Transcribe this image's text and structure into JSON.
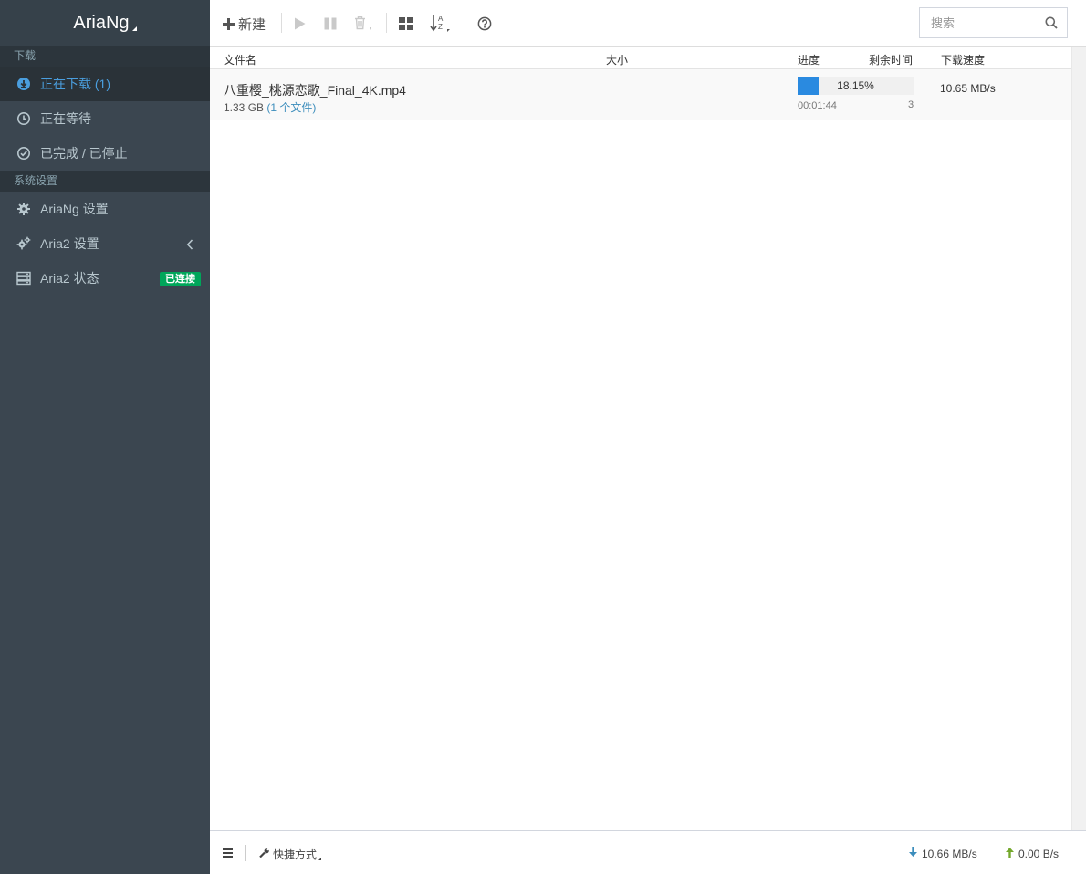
{
  "brand": {
    "title": "AriaNg"
  },
  "sidebar": {
    "sections": [
      {
        "header": "下载"
      },
      {
        "header": "系统设置"
      }
    ],
    "items": [
      {
        "label": "正在下载 (1)",
        "icon": "download-circle-icon"
      },
      {
        "label": "正在等待",
        "icon": "clock-icon"
      },
      {
        "label": "已完成 / 已停止",
        "icon": "check-circle-icon"
      },
      {
        "label": "AriaNg 设置",
        "icon": "gear-icon"
      },
      {
        "label": "Aria2 设置",
        "icon": "gears-icon"
      },
      {
        "label": "Aria2 状态",
        "icon": "server-icon",
        "badge": "已连接"
      }
    ]
  },
  "toolbar": {
    "new_label": "新建",
    "search_placeholder": "搜索"
  },
  "table": {
    "columns": [
      "文件名",
      "大小",
      "进度",
      "剩余时间",
      "下载速度"
    ],
    "rows": [
      {
        "name": "八重樱_桃源恋歌_Final_4K.mp4",
        "size": "1.33 GB",
        "file_count": "(1 个文件)",
        "progress_text": "18.15%",
        "progress": 18.15,
        "remaining": "00:01:44",
        "connections": "3",
        "speed": "10.65 MB/s"
      }
    ]
  },
  "footer": {
    "shortcut_label": "快捷方式",
    "download_speed": "10.66 MB/s",
    "upload_speed": "0.00 B/s"
  },
  "colors": {
    "sidebar_bg": "#3b4650",
    "accent": "#2a8ae0",
    "badge_green": "#00a65a"
  }
}
